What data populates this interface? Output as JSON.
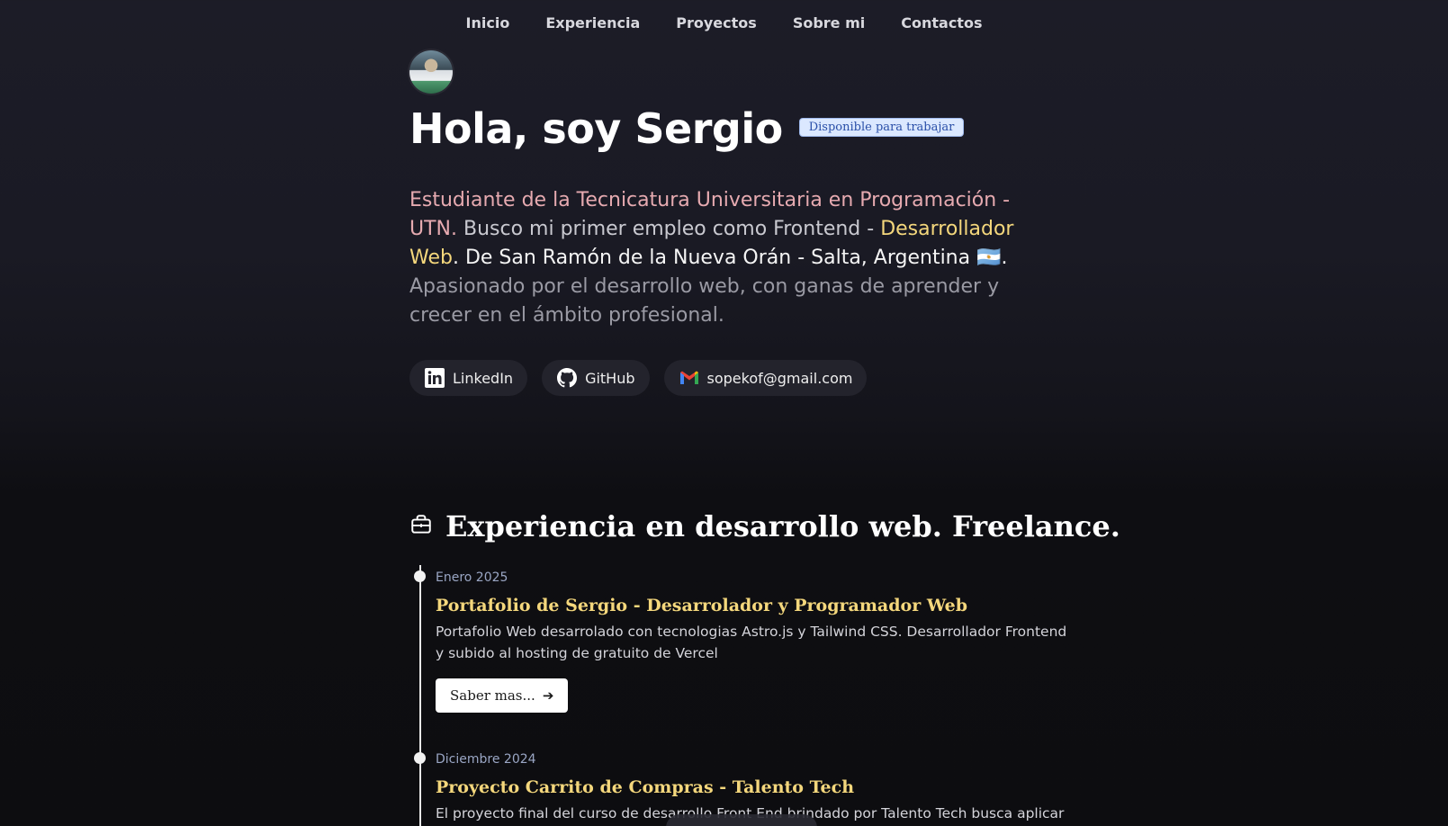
{
  "nav": {
    "items": [
      "Inicio",
      "Experiencia",
      "Proyectos",
      "Sobre mi",
      "Contactos"
    ]
  },
  "hero": {
    "title": "Hola, soy Sergio",
    "badge": "Disponible para trabajar",
    "intro_pink": "Estudiante de la Tecnicatura Universitaria en Programación - UTN.",
    "intro_gray": " Busco mi primer empleo como Frontend - ",
    "intro_yellow": "Desarrollador Web",
    "intro_white": ". De San Ramón de la Nueva Orán - Salta, Argentina 🇦🇷.",
    "intro_muted": " Apasionado por el desarrollo web, con ganas de aprender y crecer en el ámbito profesional."
  },
  "socials": {
    "linkedin": "LinkedIn",
    "github": "GitHub",
    "email": "sopekof@gmail.com"
  },
  "experience": {
    "title": "Experiencia en desarrollo web. Freelance.",
    "entries": [
      {
        "date": "Enero 2025",
        "title": "Portafolio de Sergio - Desarrolador y Programador Web",
        "description": "Portafolio Web desarrolado con tecnologias Astro.js y Tailwind CSS. Desarrollador Frontend y subido al hosting de gratuito de Vercel",
        "button": "Saber mas..."
      },
      {
        "date": "Diciembre 2024",
        "title": "Proyecto Carrito de Compras - Talento Tech",
        "description": "El proyecto final del curso de desarrollo Front End brindado por Talento Tech busca aplicar los"
      }
    ]
  },
  "colors": {
    "accent_yellow": "#f4d77c",
    "badge_bg": "#dbe8ff",
    "badge_text": "#2a4fa8"
  }
}
